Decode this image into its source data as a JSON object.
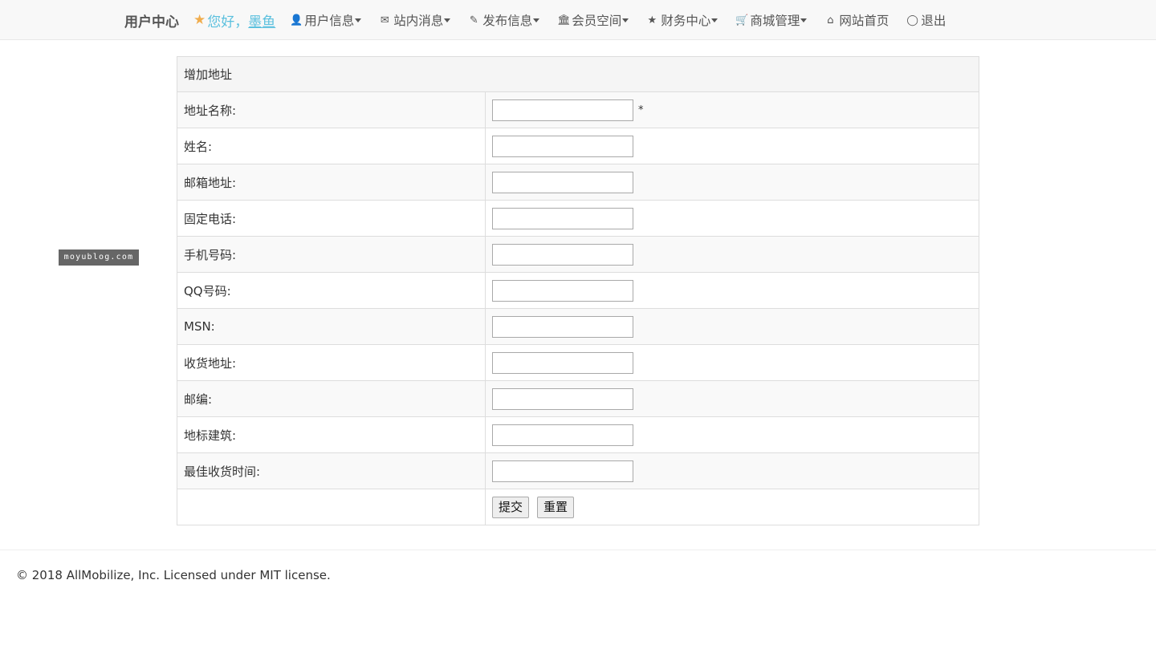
{
  "nav": {
    "brand": "用户中心",
    "greeting": "您好，",
    "username": "墨鱼",
    "items": [
      {
        "label": "用户信息",
        "icon": "user-icon",
        "glyph": "👤",
        "dropdown": true
      },
      {
        "label": "站内消息",
        "icon": "envelope-icon",
        "glyph": "✉",
        "dropdown": true
      },
      {
        "label": "发布信息",
        "icon": "edit-icon",
        "glyph": "✎",
        "dropdown": true
      },
      {
        "label": "会员空间",
        "icon": "bank-icon",
        "glyph": "🏛",
        "dropdown": true
      },
      {
        "label": "财务中心",
        "icon": "star-icon",
        "glyph": "★",
        "dropdown": true
      },
      {
        "label": "商城管理",
        "icon": "cart-icon",
        "glyph": "🛒",
        "dropdown": true
      },
      {
        "label": "网站首页",
        "icon": "home-icon",
        "glyph": "⌂",
        "dropdown": false
      },
      {
        "label": "退出",
        "icon": "power-icon",
        "glyph": "◯",
        "dropdown": false
      }
    ]
  },
  "watermark": "moyublog.com",
  "form": {
    "title": "增加地址",
    "required_mark": "*",
    "fields": [
      {
        "label": "地址名称:",
        "value": ""
      },
      {
        "label": "姓名:",
        "value": ""
      },
      {
        "label": "邮箱地址:",
        "value": ""
      },
      {
        "label": "固定电话:",
        "value": ""
      },
      {
        "label": "手机号码:",
        "value": ""
      },
      {
        "label": "QQ号码:",
        "value": ""
      },
      {
        "label": "MSN:",
        "value": ""
      },
      {
        "label": "收货地址:",
        "value": ""
      },
      {
        "label": "邮编:",
        "value": ""
      },
      {
        "label": "地标建筑:",
        "value": ""
      },
      {
        "label": "最佳收货时间:",
        "value": ""
      }
    ],
    "submit_label": "提交",
    "reset_label": "重置"
  },
  "footer": {
    "text": "© 2018 AllMobilize, Inc. Licensed under MIT license."
  }
}
